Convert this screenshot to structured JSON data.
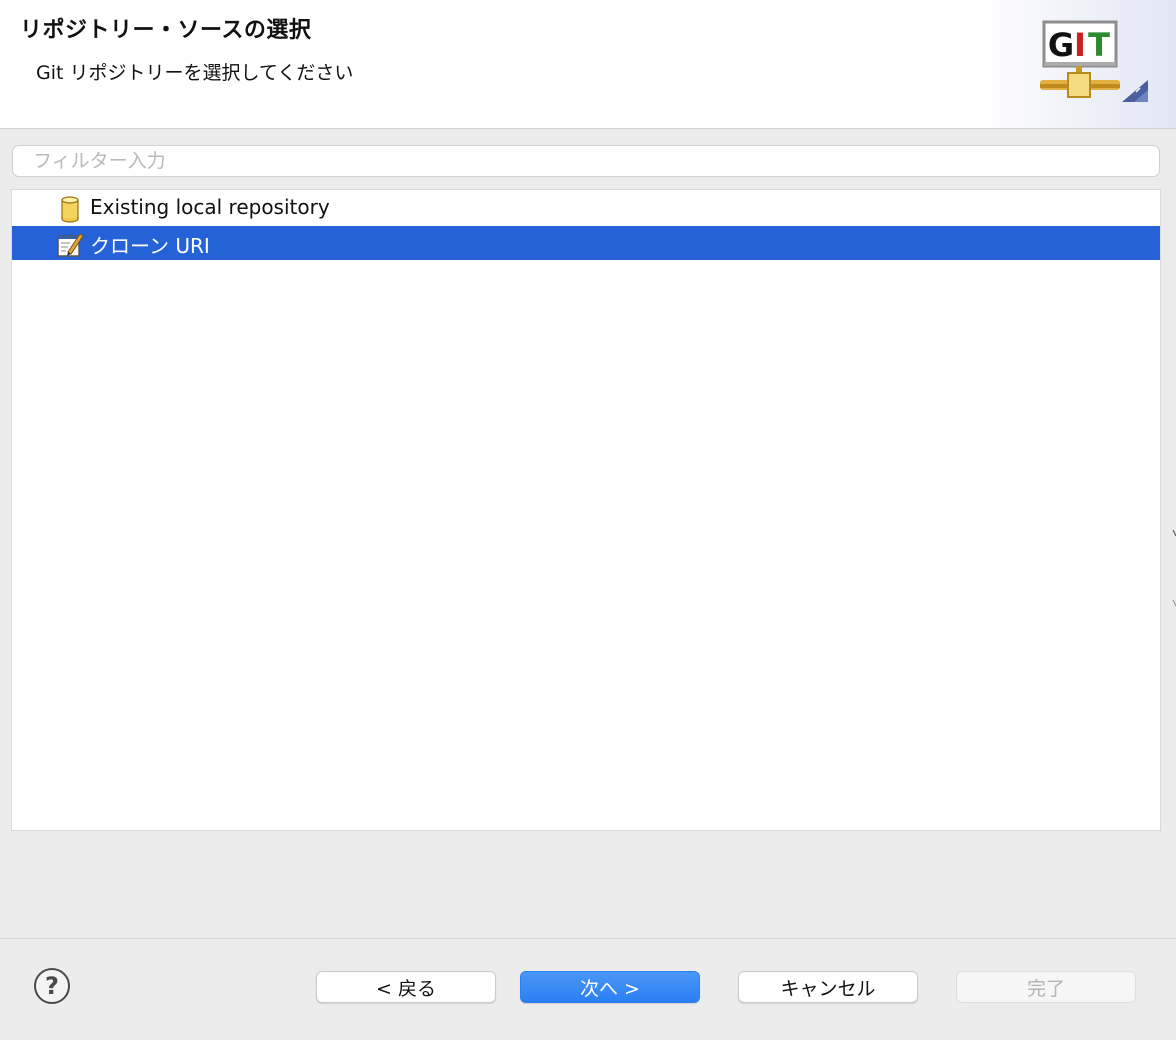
{
  "banner": {
    "title": "リポジトリー・ソースの選択",
    "description": "Git リポジトリーを選択してください",
    "logo_text": [
      "G",
      "I",
      "T"
    ],
    "logo_colors": {
      "G": "#111111",
      "I": "#cc1f1f",
      "T": "#2e8a2e"
    }
  },
  "filter": {
    "placeholder": "フィルター入力",
    "value": ""
  },
  "tree": {
    "items": [
      {
        "label": "Existing local repository",
        "icon": "database-icon",
        "selected": false
      },
      {
        "label": "クローン URI",
        "icon": "edit-document-icon",
        "selected": true
      }
    ]
  },
  "buttons": {
    "help": "?",
    "back": "< 戻る",
    "next": "次へ >",
    "cancel": "キャンセル",
    "finish": "完了"
  },
  "colors": {
    "selection": "#2562d8",
    "primary_button": "#2a7ff3"
  }
}
